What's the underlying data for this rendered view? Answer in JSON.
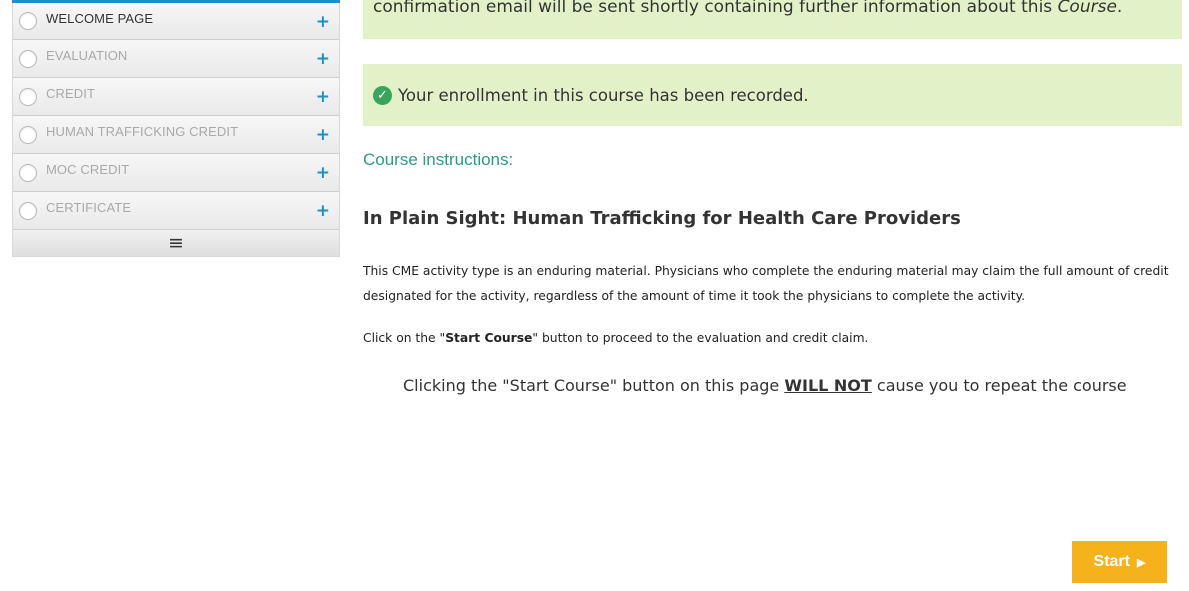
{
  "sidebar": {
    "items": [
      {
        "label": "WELCOME PAGE",
        "state": "active",
        "expand_icon": "+"
      },
      {
        "label": "EVALUATION",
        "state": "disabled",
        "expand_icon": "+"
      },
      {
        "label": "CREDIT",
        "state": "disabled",
        "expand_icon": "+"
      },
      {
        "label": "HUMAN TRAFFICKING CREDIT",
        "state": "disabled",
        "expand_icon": "+"
      },
      {
        "label": "MOC CREDIT",
        "state": "disabled",
        "expand_icon": "+"
      },
      {
        "label": "CERTIFICATE",
        "state": "disabled",
        "expand_icon": "+"
      }
    ],
    "menu_icon": "≡"
  },
  "notices": {
    "top_text_prefix": "confirmation email will be sent shortly containing further information about this ",
    "top_text_emph": "Course",
    "top_text_suffix": ".",
    "enrollment": "Your enrollment in this course has been recorded.",
    "check_icon": "✓"
  },
  "content": {
    "instructions_heading": "Course instructions:",
    "course_title": "In Plain Sight: Human Trafficking for Health Care Providers",
    "description": "This CME activity type is an enduring material.  Physicians who complete the enduring material may claim the full amount of credit designated for the activity, regardless of the amount of time it took the physicians to complete the activity.",
    "click_prefix": "Click on the  \"",
    "click_bold": "Start Course",
    "click_suffix": "\" button to proceed to the evaluation and credit claim.",
    "warning_prefix": "Clicking the \"Start Course\" button on this page ",
    "warning_strong": "WILL NOT",
    "warning_suffix": " cause you to repeat the course"
  },
  "start_button": {
    "label": "Start",
    "arrow_icon": "▶"
  },
  "colors": {
    "accent": "#1e8fc6",
    "notice_bg": "#e2f1c8",
    "success": "#3aa55a",
    "heading_teal": "#2e9a84",
    "button": "#f6b21b"
  }
}
